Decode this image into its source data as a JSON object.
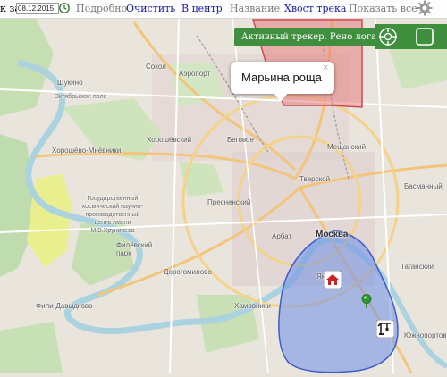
{
  "toolbar": {
    "prefix": "к за",
    "date_value": "08.12.2015",
    "details": "Подробно",
    "clear": "Очистить",
    "center": "В центр",
    "name": "Название",
    "track_tail": "Хвост трека",
    "show_all": "Показать все"
  },
  "tracker": {
    "label": "Активный трекер. Рено логан"
  },
  "popup": {
    "title": "Марьина роща",
    "close": "×"
  },
  "map": {
    "labels": {
      "sokol": "Сокол",
      "aeroport": "Аэропорт",
      "shchukino": "Щукино",
      "oktyabrskoe_pole": "Октябрьское поле",
      "khoroshevsky": "Хорошёвский",
      "khoroshevo_mnevniki": "Хорошёво-Мнёвники",
      "begovoe": "Беговое",
      "meshchansky": "Мещанский",
      "tverskoy": "Тверской",
      "basmanny": "Басманный",
      "presnensky": "Пресненский",
      "arbat": "Арбат",
      "moskva": "Москва",
      "filevsky_park": "Филёвский парк",
      "dorogomilovo": "Дорогомилово",
      "fili_davydkovo": "Фили-Давыдково",
      "khamovniki": "Хамовники",
      "yakimanka": "Яки...",
      "taganka": "Таганский",
      "yuzhnoportovy": "Южнопортовы",
      "khrunichev": "Государственный космический научно-производственный центр имени М.В.Хруничева"
    }
  },
  "colors": {
    "tracker_bg": "#3f8f3f",
    "popup_bg": "#ffffff",
    "zone_red": "#e06060",
    "zone_blue": "#6f8fe6",
    "marker_green": "#2e9a2e",
    "toolbar_link": "#1a1aa6"
  },
  "icons": {
    "calendar": "calendar-icon",
    "gear": "gear-icon",
    "crosshair": "crosshair-icon",
    "square": "square-icon",
    "home": "home-icon",
    "crane": "crane-icon",
    "gps": "gps-marker-icon"
  }
}
